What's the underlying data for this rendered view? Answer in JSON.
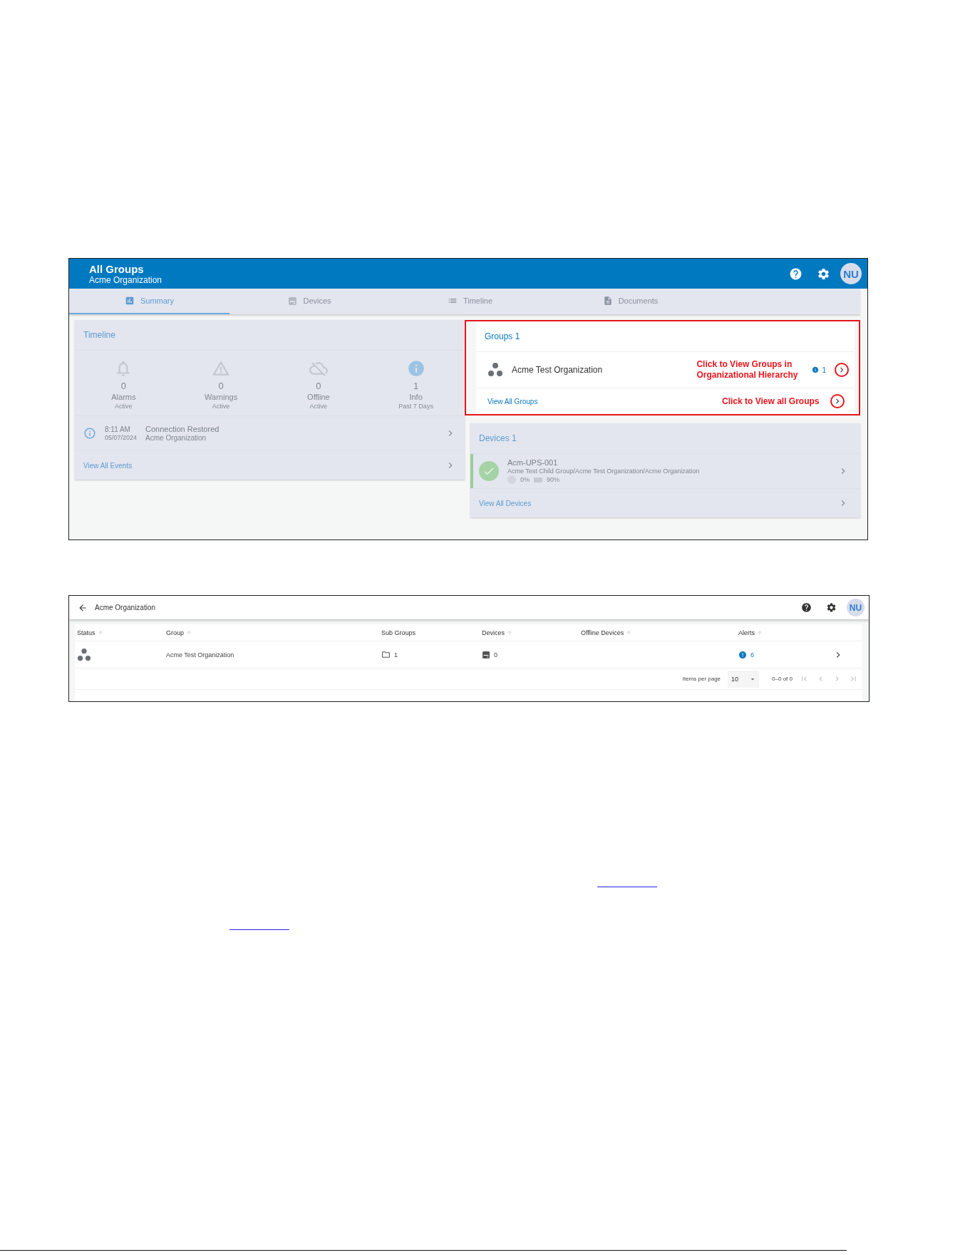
{
  "summary_screen": {
    "header": {
      "title": "All Groups",
      "subtitle": "Acme Organization",
      "avatar": "NU"
    },
    "tabs": [
      {
        "label": "Summary",
        "kind": "chart",
        "selected": true
      },
      {
        "label": "Devices",
        "kind": "device",
        "selected": false
      },
      {
        "label": "Timeline",
        "kind": "list",
        "selected": false
      },
      {
        "label": "Documents",
        "kind": "document",
        "selected": false
      }
    ],
    "timeline": {
      "title": "Timeline",
      "stats": [
        {
          "kind": "alarm",
          "count": "0",
          "label": "Alarms",
          "sub": "Active"
        },
        {
          "kind": "warning",
          "count": "0",
          "label": "Warnings",
          "sub": "Active"
        },
        {
          "kind": "offline",
          "count": "0",
          "label": "Offline",
          "sub": "Active"
        },
        {
          "kind": "info",
          "count": "1",
          "label": "Info",
          "sub": "Past 7 Days"
        }
      ],
      "event": {
        "time": "8:11 AM",
        "date": "05/07/2024",
        "title": "Connection Restored",
        "subtitle": "Acme Organization"
      },
      "view_all": "View All Events"
    },
    "groups": {
      "title": "Groups 1",
      "items": [
        {
          "name": "Acme Test Organization",
          "alert_count": "1",
          "note": "Click to View Groups in Organizational Hierarchy"
        }
      ],
      "view_all": "View All Groups",
      "view_all_note": "Click to View all Groups"
    },
    "devices": {
      "title": "Devices 1",
      "items": [
        {
          "name": "Acm-UPS-001",
          "healthy": true,
          "path": "Acme Test Child Group/Acme Test Organization/Acme Organization",
          "signal": "0%",
          "battery": "90%"
        }
      ],
      "view_all": "View All Devices"
    }
  },
  "groups_screen": {
    "header": {
      "title": "Acme Organization",
      "avatar": "NU"
    },
    "columns": [
      {
        "label": "Status",
        "sortable": true
      },
      {
        "label": "Group",
        "sortable": true
      },
      {
        "label": "Sub Groups",
        "sortable": false
      },
      {
        "label": "Devices",
        "sortable": true
      },
      {
        "label": "Offline Devices",
        "sortable": true
      },
      {
        "label": "Alerts",
        "sortable": true
      }
    ],
    "rows": [
      {
        "group": "Acme Test Organization",
        "sub_groups": "1",
        "devices": "0",
        "alerts": "6"
      }
    ],
    "pagination": {
      "label": "Items per page",
      "per_page": "10",
      "range": "0–0 of 0"
    }
  }
}
